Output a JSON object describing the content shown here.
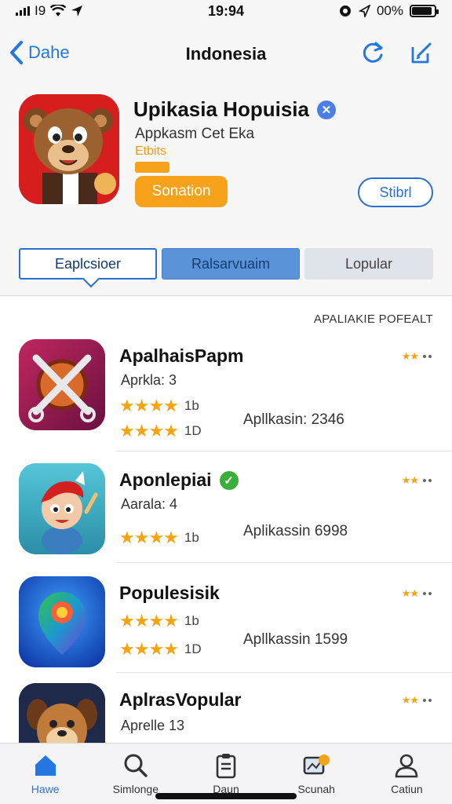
{
  "status_bar": {
    "carrier": "I9",
    "time": "19:94",
    "battery_text": "00%",
    "battery_level": 0.9
  },
  "nav": {
    "back_label": "Dahe",
    "title": "Indonesia"
  },
  "hero": {
    "name": "Upikasia Hopuisia",
    "subtitle": "Appkasm Cet Eka",
    "tag": "Etbits",
    "primary_button": "Sonation",
    "secondary_button": "Stibrl"
  },
  "segments": [
    "Eaplcsioer",
    "Ralsarvuaim",
    "Lopular"
  ],
  "section_header": "APALIAKIE POFEALT",
  "apps": [
    {
      "name": "ApalhaisPapm",
      "subtitle": "Aprkla: 3",
      "stars_1": "★★★★",
      "count_1": "1b",
      "stars_2": "★★★★",
      "count_2": "1D",
      "downloads": "Apllkasin: 2346",
      "mini_stars": "★★",
      "verified": false
    },
    {
      "name": "Aponlepiai",
      "subtitle": "Aarala: 4",
      "stars_1": "★★★★",
      "count_1": "1b",
      "downloads": "Aplikassin 6998",
      "mini_stars": "★★",
      "verified": true
    },
    {
      "name": "Populesisik",
      "stars_1": "★★★★",
      "count_1": "1b",
      "stars_2": "★★★★",
      "count_2": "1D",
      "downloads": "Apllkassin 1599",
      "mini_stars": "★★",
      "verified": false
    },
    {
      "name": "AplrasVopular",
      "subtitle": "Aprelle 13",
      "mini_stars": "★★",
      "verified": false
    }
  ],
  "tabs": [
    {
      "label": "Hawe",
      "icon": "home-icon",
      "active": true
    },
    {
      "label": "Simlonge",
      "icon": "search-icon",
      "active": false
    },
    {
      "label": "Daun",
      "icon": "clipboard-icon",
      "active": false
    },
    {
      "label": "Scunah",
      "icon": "updates-icon",
      "active": false
    },
    {
      "label": "Catiun",
      "icon": "person-icon",
      "active": false
    }
  ],
  "colors": {
    "accent": "#2477e0",
    "orange": "#f7a21b",
    "star": "#f5a40f",
    "verified_green": "#3cae3c"
  }
}
